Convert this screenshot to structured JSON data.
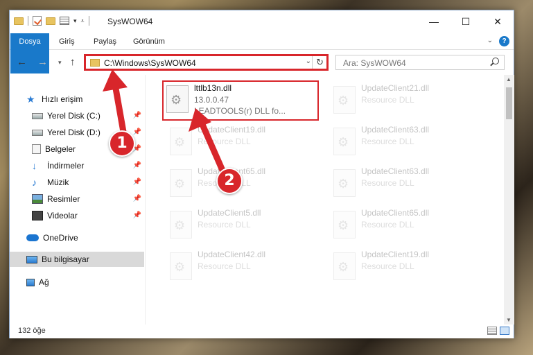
{
  "window": {
    "title": "SysWOW64"
  },
  "ribbon": {
    "tabs": [
      "Dosya",
      "Giriş",
      "Paylaş",
      "Görünüm"
    ]
  },
  "address": {
    "path": "C:\\Windows\\SysWOW64"
  },
  "search": {
    "placeholder": "Ara: SysWOW64"
  },
  "sidebar": {
    "quick_access": "Hızlı erişim",
    "items": [
      {
        "label": "Yerel Disk (C:)",
        "icon": "disk-icon",
        "pinned": true
      },
      {
        "label": "Yerel Disk (D:)",
        "icon": "disk-icon",
        "pinned": true
      },
      {
        "label": "Belgeler",
        "icon": "documents-icon",
        "pinned": true
      },
      {
        "label": "İndirmeler",
        "icon": "download-icon",
        "pinned": true
      },
      {
        "label": "Müzik",
        "icon": "music-icon",
        "pinned": true
      },
      {
        "label": "Resimler",
        "icon": "pictures-icon",
        "pinned": true
      },
      {
        "label": "Videolar",
        "icon": "videos-icon",
        "pinned": true
      }
    ],
    "onedrive": "OneDrive",
    "this_pc": "Bu bilgisayar",
    "network": "Ağ"
  },
  "files": [
    {
      "name": "lttlb13n.dll",
      "version": "13.0.0.47",
      "desc": "LEADTOOLS(r) DLL fo..."
    },
    {
      "name": "UpdateClient21.dll",
      "desc": "Resource DLL"
    },
    {
      "name": "UpdateClient19.dll",
      "desc": "Resource DLL"
    },
    {
      "name": "UpdateClient63.dll",
      "desc": "Resource DLL"
    },
    {
      "name": "UpdateClient65.dll",
      "desc": "Resource DLL"
    },
    {
      "name": "UpdateClient63.dll",
      "desc": "Resource DLL"
    },
    {
      "name": "UpdateClient5.dll",
      "desc": "Resource DLL"
    },
    {
      "name": "UpdateClient65.dll",
      "desc": "Resource DLL"
    },
    {
      "name": "UpdateClient42.dll",
      "desc": "Resource DLL"
    },
    {
      "name": "UpdateClient19.dll",
      "desc": "Resource DLL"
    }
  ],
  "status": {
    "count": "132 öğe"
  },
  "annotations": {
    "badge1": "1",
    "badge2": "2",
    "color": "#d8262b"
  }
}
